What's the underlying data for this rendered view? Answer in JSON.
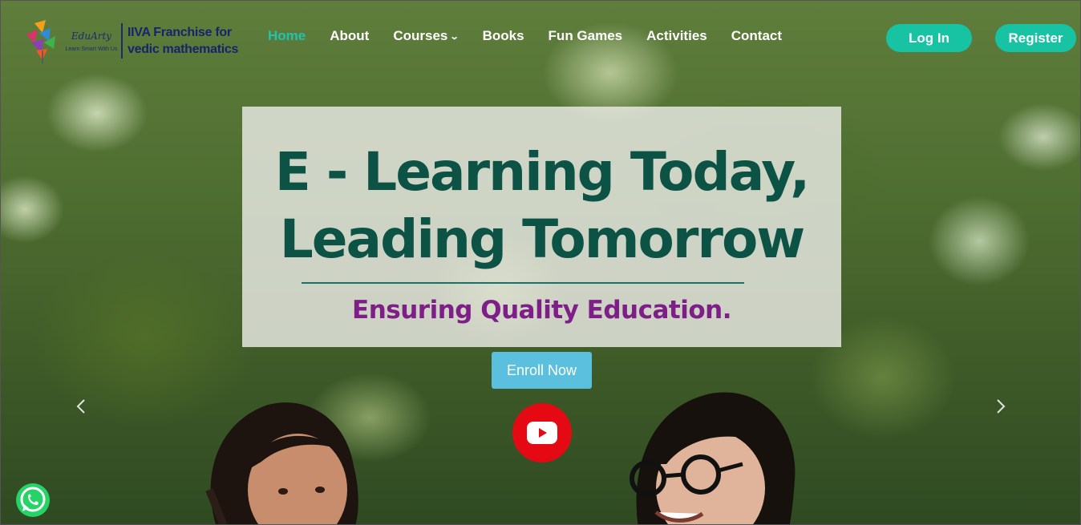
{
  "header": {
    "logo": {
      "brand": "EduArty",
      "tagline": "Learn Smart With Us",
      "franchise_line1": "IIVA Franchise for",
      "franchise_line2": "vedic mathematics"
    },
    "nav": [
      {
        "label": "Home",
        "active": true
      },
      {
        "label": "About",
        "active": false
      },
      {
        "label": "Courses",
        "active": false,
        "has_dropdown": true
      },
      {
        "label": "Books",
        "active": false
      },
      {
        "label": "Fun Games",
        "active": false
      },
      {
        "label": "Activities",
        "active": false
      },
      {
        "label": "Contact",
        "active": false
      }
    ],
    "login_label": "Log In",
    "register_label": "Register"
  },
  "hero": {
    "headline_line1": "E - Learning Today,",
    "headline_line2": "Leading Tomorrow",
    "subline": "Ensuring Quality Education.",
    "enroll_label": "Enroll Now"
  },
  "icons": {
    "youtube": "youtube-play-icon",
    "prev": "chevron-left-icon",
    "next": "chevron-right-icon",
    "whatsapp": "whatsapp-icon",
    "dropdown": "chevron-down-icon"
  },
  "colors": {
    "accent": "#18c3a4",
    "active_nav": "#21c3b0",
    "headline": "#0c5245",
    "subline": "#7d1f86",
    "enroll": "#5bc0de",
    "youtube": "#e50914"
  }
}
